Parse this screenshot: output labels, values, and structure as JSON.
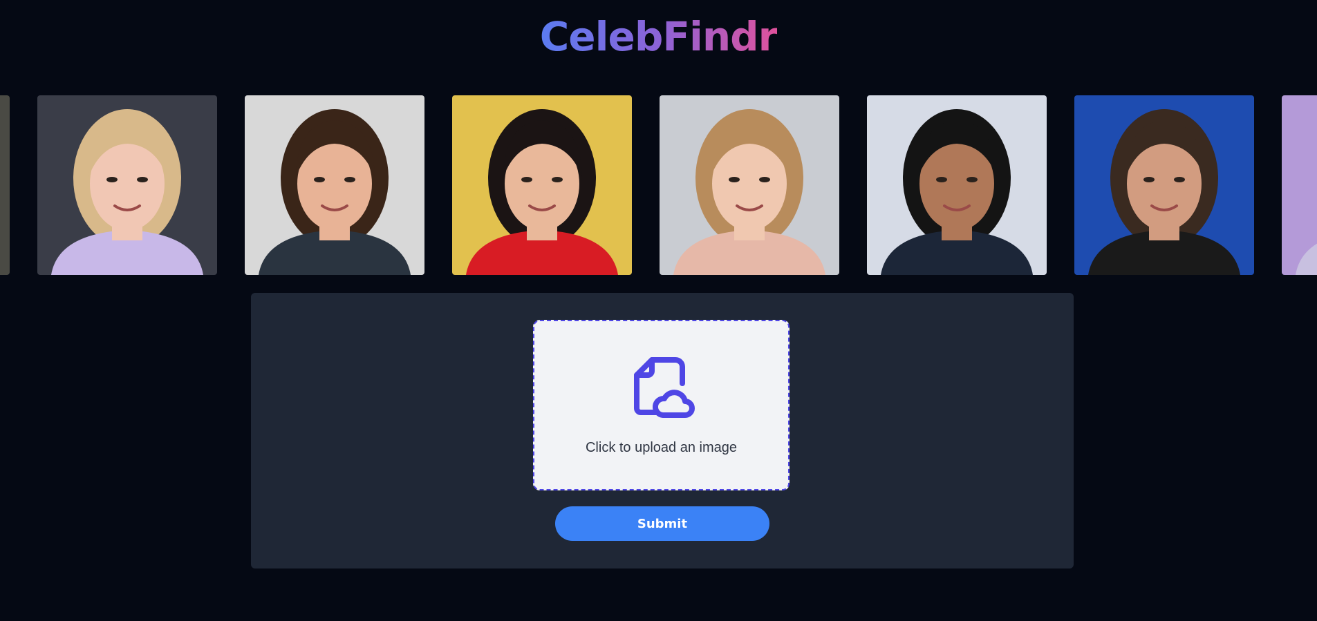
{
  "app": {
    "logo_text": "CelebFindr",
    "logo_gradient": [
      "#5b7cf2",
      "#8c63d8",
      "#e0529c"
    ]
  },
  "carousel": {
    "images": [
      {
        "name": "celebrity-photo-partial-left",
        "bg": "#4a4a44",
        "skin": "#9aa3a8",
        "hair": "#3a3530",
        "top": "#7fa8b8"
      },
      {
        "name": "celebrity-photo-1",
        "bg": "#3a3d48",
        "skin": "#f1c7b4",
        "hair": "#d8b98a",
        "top": "#c8b8e8"
      },
      {
        "name": "celebrity-photo-2",
        "bg": "#d8d8d8",
        "skin": "#e8b396",
        "hair": "#3a2518",
        "top": "#2a3440"
      },
      {
        "name": "celebrity-photo-3",
        "bg": "#e2c14e",
        "skin": "#e9b89a",
        "hair": "#1b1414",
        "top": "#d81c24"
      },
      {
        "name": "celebrity-photo-4",
        "bg": "#c9ccd2",
        "skin": "#f0c8b0",
        "hair": "#b88c5c",
        "top": "#e6b8a8"
      },
      {
        "name": "celebrity-photo-5",
        "bg": "#d6dbe6",
        "skin": "#b07858",
        "hair": "#141414",
        "top": "#1c2638"
      },
      {
        "name": "celebrity-photo-6",
        "bg": "#1e4cb0",
        "skin": "#d29c80",
        "hair": "#3a2a20",
        "top": "#1a1a1a"
      },
      {
        "name": "celebrity-photo-partial-right",
        "bg": "#b49ad8",
        "skin": "#e8c0a8",
        "hair": "#1a1a1a",
        "top": "#c8c0e0"
      }
    ]
  },
  "upload": {
    "label": "Click to upload an image",
    "icon": "file-upload-cloud-icon",
    "accent": "#4f46e5"
  },
  "submit": {
    "label": "Submit",
    "color": "#3b82f6"
  }
}
